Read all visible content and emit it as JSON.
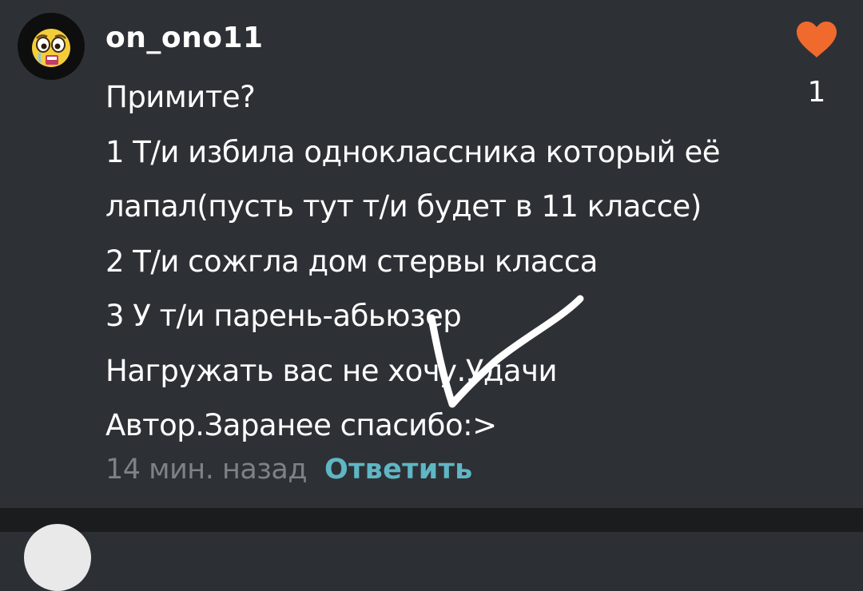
{
  "comment": {
    "username": "on_ono11",
    "avatar_icon": "crying-emoji-avatar-icon",
    "lines": [
      "Примите?",
      "1 Т/и избила одноклассника который её",
      "лапал(пусть тут т/и будет в 11 классе)",
      "2 Т/и сожгла дом стервы класса",
      "3 У т/и парень-абьюзер",
      "Нагружать вас не хочу.Удачи",
      "Автор.Заранее спасибо:>"
    ],
    "time_ago": "14 мин. назад",
    "reply_label": "Ответить",
    "likes": {
      "icon": "heart-icon",
      "count": "1",
      "color": "#f06a2e"
    }
  },
  "overlay": {
    "icon": "checkmark-drawing",
    "color": "#ffffff"
  },
  "colors": {
    "background": "#2d3135",
    "muted_text": "#7d8286",
    "reply_accent": "#5fb6c4"
  }
}
